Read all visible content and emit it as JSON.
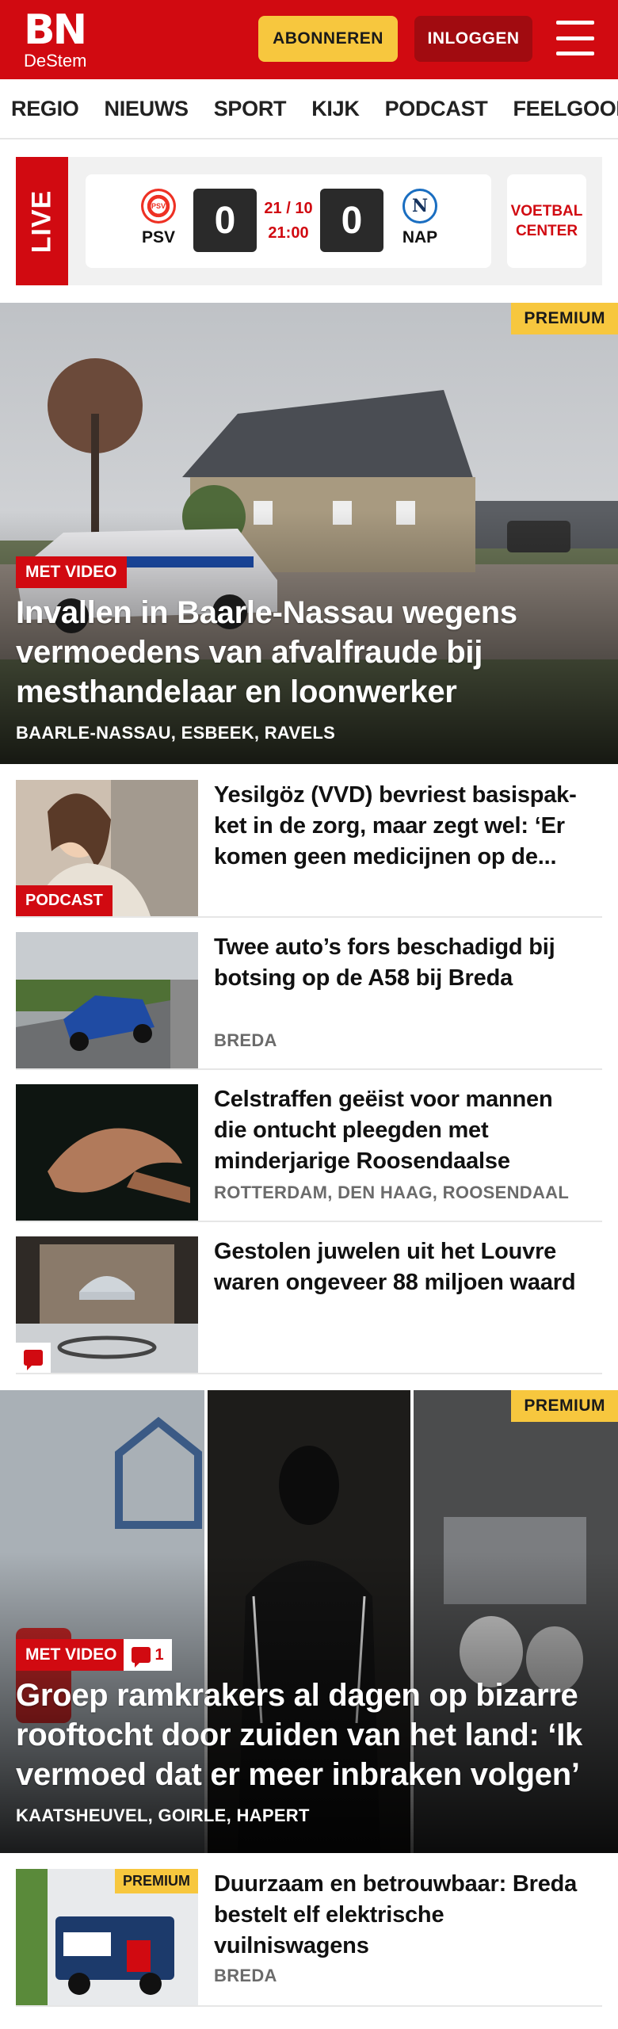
{
  "header": {
    "logo_main": "BN",
    "logo_sub": "DeStem",
    "subscribe_label": "ABONNEREN",
    "login_label": "INLOGGEN",
    "menu_icon": "hamburger-menu-icon"
  },
  "nav": {
    "items": [
      "REGIO",
      "NIEUWS",
      "SPORT",
      "KIJK",
      "PODCAST",
      "FEELGOOD"
    ]
  },
  "live": {
    "label": "LIVE",
    "match": {
      "home_team": "PSV",
      "away_team": "NAP",
      "home_score": "0",
      "away_score": "0",
      "date": "21 / 10",
      "time": "21:00",
      "home_badge_text": "PSV",
      "away_badge_text": "N"
    },
    "center_label": "VOETBAL CENTER"
  },
  "hero1": {
    "premium": "PREMIUM",
    "tag": "MET VIDEO",
    "title": "Invallen in Baarle-Nassau wegens vermoedens van afvalfraude bij mesthandelaar en loonwerker",
    "location": "BAARLE-NASSAU, ESBEEK, RAVELS"
  },
  "articles": [
    {
      "title": "Yesilgöz (VVD) bevriest basispak­ket in de zorg, maar zegt wel: ‘Er komen geen medicijnen op de...",
      "tag": "PODCAST"
    },
    {
      "title": "Twee auto’s fors beschadigd bij botsing op de A58 bij Breda",
      "location": "BREDA"
    },
    {
      "title": "Celstraffen geëist voor mannen die ontucht pleegden met minderjarige Roosendaalse",
      "location": "ROTTERDAM, DEN HAAG, ROOSENDAAL"
    },
    {
      "title": "Gestolen juwelen uit het Louvre waren ongeveer 88 miljoen waard",
      "icon": "comment-icon"
    }
  ],
  "hero2": {
    "premium": "PREMIUM",
    "tag": "MET VIDEO",
    "comments": "1",
    "title": "Groep ramkrakers al dagen op bizarre rooftocht door zuiden van het land: ‘Ik vermoed dat er meer inbraken volgen’",
    "location": "KAATSHEUVEL, GOIRLE, HAPERT"
  },
  "article5": {
    "premium": "PREMIUM",
    "title": "Duurzaam en betrouwbaar: Breda bestelt elf elektrische vuilniswagens",
    "location": "BREDA"
  },
  "colors": {
    "brand_red": "#d10a11",
    "premium_yellow": "#f7c73e",
    "login_dark_red": "#a10b10"
  }
}
